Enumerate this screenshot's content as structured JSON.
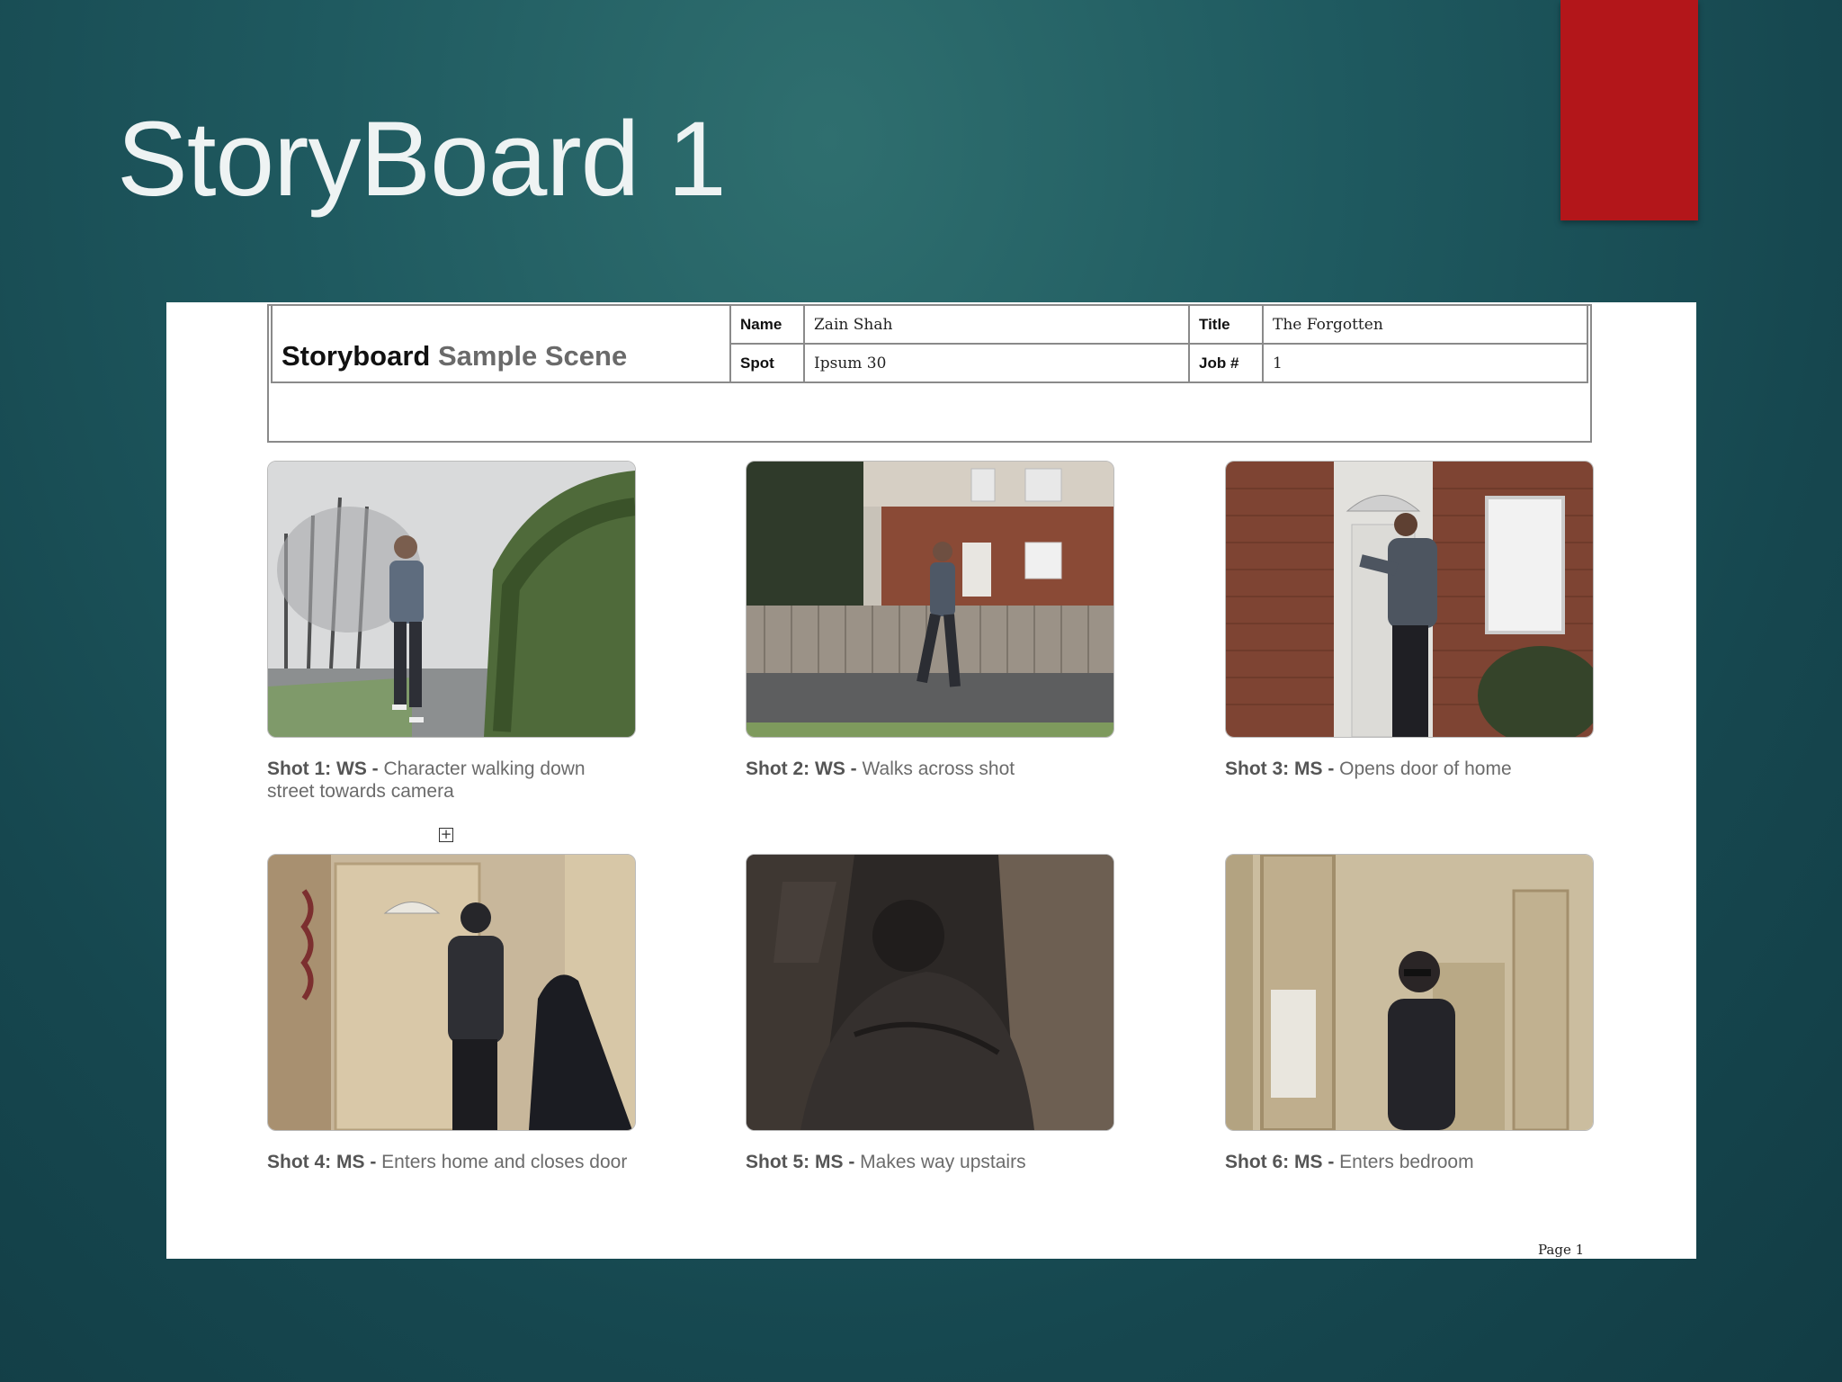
{
  "slide": {
    "title": "StoryBoard 1"
  },
  "header": {
    "title_main": "Storyboard",
    "title_sub": "Sample Scene",
    "name_label": "Name",
    "name_value": "Zain Shah",
    "title_label": "Title",
    "title_value": "The Forgotten",
    "spot_label": "Spot",
    "spot_value": "Ipsum 30",
    "job_label": "Job #",
    "job_value": "1"
  },
  "shots": [
    {
      "label": "Shot 1: WS -",
      "desc": "Character walking down street towards camera"
    },
    {
      "label": "Shot 2: WS -",
      "desc": "Walks across shot"
    },
    {
      "label": "Shot 3: MS -",
      "desc": "Opens door of home"
    },
    {
      "label": "Shot 4: MS -",
      "desc": "Enters home and closes door"
    },
    {
      "label": "Shot 5: MS -",
      "desc": "Makes way upstairs"
    },
    {
      "label": "Shot 6: MS -",
      "desc": "Enters bedroom"
    }
  ],
  "footer": {
    "page": "Page  1"
  },
  "colors": {
    "accent": "#b3161a",
    "background": "#1f5a60"
  }
}
